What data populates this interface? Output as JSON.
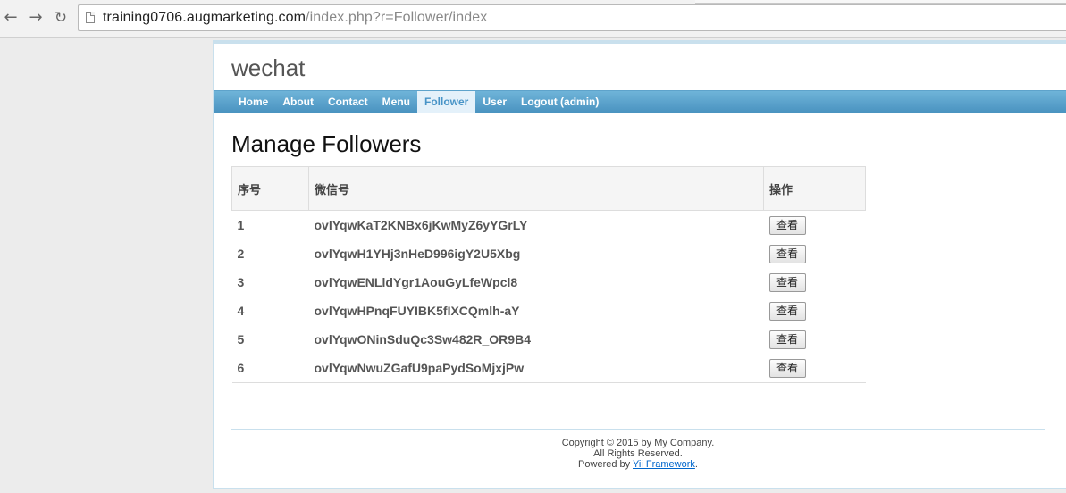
{
  "browser": {
    "url_host": "training0706.augmarketing.com",
    "url_path": "/index.php?r=Follower/index"
  },
  "site": {
    "logo": "wechat"
  },
  "menu": {
    "items": [
      {
        "label": "Home"
      },
      {
        "label": "About"
      },
      {
        "label": "Contact"
      },
      {
        "label": "Menu"
      },
      {
        "label": "Follower"
      },
      {
        "label": "User"
      },
      {
        "label": "Logout (admin)"
      }
    ],
    "active": "Follower"
  },
  "page": {
    "title": "Manage Followers"
  },
  "grid": {
    "headers": [
      "序号",
      "微信号",
      "操作"
    ],
    "rows": [
      {
        "id": "1",
        "openid": "ovlYqwKaT2KNBx6jKwMyZ6yYGrLY",
        "action": "查看"
      },
      {
        "id": "2",
        "openid": "ovlYqwH1YHj3nHeD996igY2U5Xbg",
        "action": "查看"
      },
      {
        "id": "3",
        "openid": "ovlYqwENLldYgr1AouGyLfeWpcl8",
        "action": "查看"
      },
      {
        "id": "4",
        "openid": "ovlYqwHPnqFUYIBK5fIXCQmlh-aY",
        "action": "查看"
      },
      {
        "id": "5",
        "openid": "ovlYqwONinSduQc3Sw482R_OR9B4",
        "action": "查看"
      },
      {
        "id": "6",
        "openid": "ovlYqwNwuZGafU9paPydSoMjxjPw",
        "action": "查看"
      }
    ]
  },
  "footer": {
    "copyright": "Copyright © 2015 by My Company.",
    "rights": "All Rights Reserved.",
    "powered_prefix": "Powered by ",
    "powered_link": "Yii Framework",
    "powered_suffix": "."
  }
}
